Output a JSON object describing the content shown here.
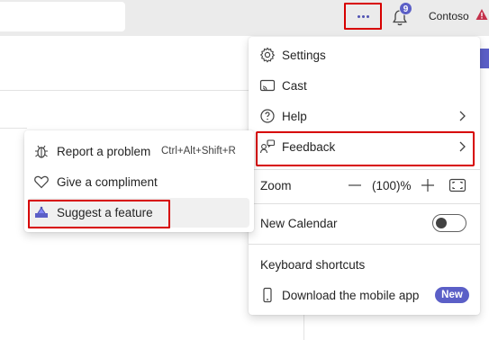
{
  "topbar": {
    "more_label": "More options",
    "notification_count": "9",
    "org_name": "Contoso"
  },
  "menu": {
    "settings": "Settings",
    "cast": "Cast",
    "help": "Help",
    "feedback": "Feedback",
    "zoom_label": "Zoom",
    "zoom_value": "(100)%",
    "new_calendar": "New Calendar",
    "new_calendar_enabled": false,
    "keyboard_shortcuts": "Keyboard shortcuts",
    "download_mobile": "Download the mobile app",
    "new_badge": "New"
  },
  "submenu": {
    "report_problem": "Report a problem",
    "report_shortcut": "Ctrl+Alt+Shift+R",
    "give_compliment": "Give a compliment",
    "suggest_feature": "Suggest a feature"
  },
  "colors": {
    "accent": "#5b5fc7",
    "highlight_border": "#d70000",
    "warning": "#c4314b"
  },
  "icons": [
    "gear-icon",
    "cast-icon",
    "help-icon",
    "feedback-icon",
    "zoom-minus-icon",
    "zoom-plus-icon",
    "fit-screen-icon",
    "keyboard-icon",
    "phone-icon",
    "bug-icon",
    "heart-icon",
    "lightbulb-icon",
    "chevron-right-icon",
    "bell-icon",
    "warning-icon",
    "more-icon"
  ]
}
